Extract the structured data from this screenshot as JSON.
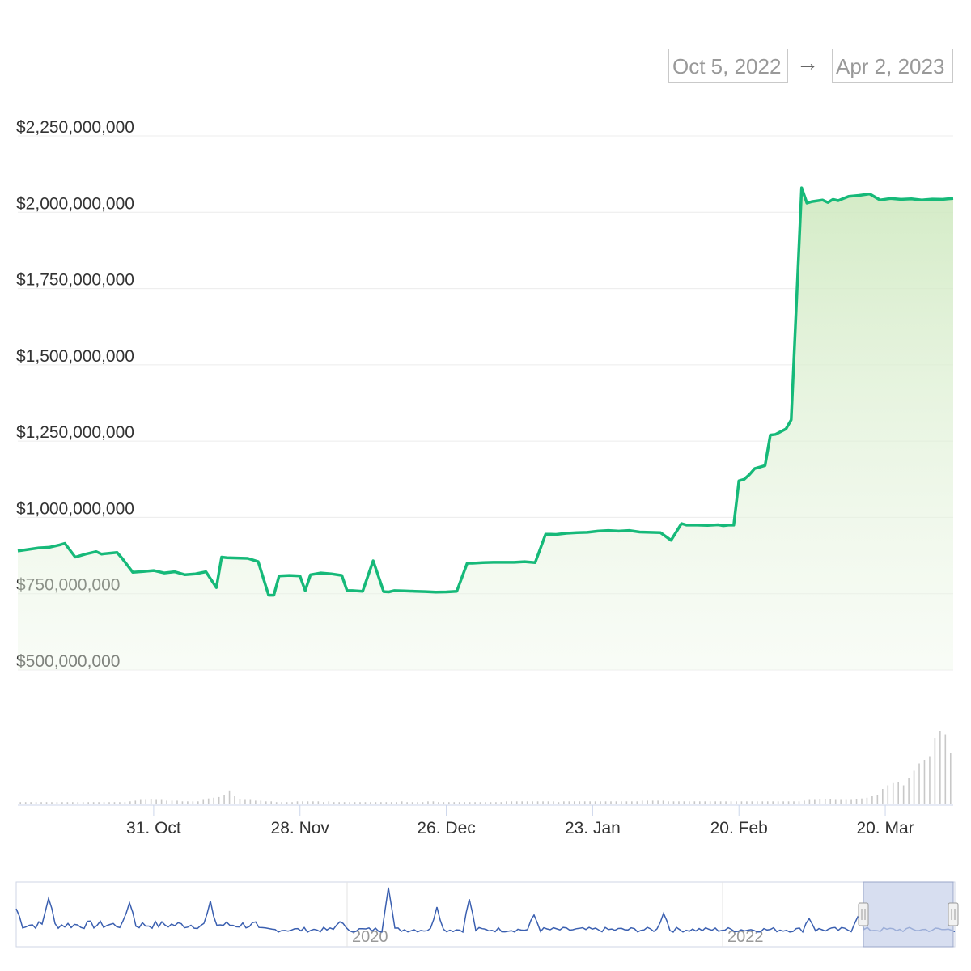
{
  "range_selector": {
    "from": "Oct 5, 2022",
    "arrow": "→",
    "to": "Apr 2, 2023"
  },
  "colors": {
    "line": "#16b979",
    "area_top": "#cfe9c0",
    "volume": "#c8c8c8",
    "navigator_line": "#3a5fb0",
    "navigator_mask": "#c6d0ea"
  },
  "chart_data": {
    "type": "area",
    "ylim": [
      500000000,
      2250000000
    ],
    "y_ticks": [
      500000000,
      750000000,
      1000000000,
      1250000000,
      1500000000,
      1750000000,
      2000000000,
      2250000000
    ],
    "y_tick_labels": [
      "$500,000,000",
      "$750,000,000",
      "$1,000,000,000",
      "$1,250,000,000",
      "$1,500,000,000",
      "$1,750,000,000",
      "$2,000,000,000",
      "$2,250,000,000"
    ],
    "x_range": [
      "2022-10-05",
      "2023-04-02"
    ],
    "x_ticks": [
      "2022-10-31",
      "2022-11-28",
      "2022-12-26",
      "2023-01-23",
      "2023-02-20",
      "2023-03-20"
    ],
    "x_tick_labels": [
      "31. Oct",
      "28. Nov",
      "26. Dec",
      "23. Jan",
      "20. Feb",
      "20. Mar"
    ],
    "grid": true,
    "series": [
      {
        "x": [
          "2022-10-05",
          "2022-10-07",
          "2022-10-09",
          "2022-10-11",
          "2022-10-13",
          "2022-10-14",
          "2022-10-16",
          "2022-10-18",
          "2022-10-20",
          "2022-10-21",
          "2022-10-24",
          "2022-10-25",
          "2022-10-27",
          "2022-10-29",
          "2022-10-31",
          "2022-11-02",
          "2022-11-04",
          "2022-11-06",
          "2022-11-08",
          "2022-11-10",
          "2022-11-12",
          "2022-11-13",
          "2022-11-14",
          "2022-11-16",
          "2022-11-18",
          "2022-11-20",
          "2022-11-22",
          "2022-11-23",
          "2022-11-24",
          "2022-11-26",
          "2022-11-28",
          "2022-11-29",
          "2022-11-30",
          "2022-12-02",
          "2022-12-04",
          "2022-12-06",
          "2022-12-07",
          "2022-12-08",
          "2022-12-10",
          "2022-12-12",
          "2022-12-14",
          "2022-12-15",
          "2022-12-16",
          "2022-12-18",
          "2022-12-20",
          "2022-12-22",
          "2022-12-24",
          "2022-12-26",
          "2022-12-28",
          "2022-12-30",
          "2022-12-31",
          "2023-01-02",
          "2023-01-04",
          "2023-01-06",
          "2023-01-08",
          "2023-01-10",
          "2023-01-12",
          "2023-01-14",
          "2023-01-15",
          "2023-01-16",
          "2023-01-18",
          "2023-01-20",
          "2023-01-22",
          "2023-01-24",
          "2023-01-26",
          "2023-01-28",
          "2023-01-30",
          "2023-02-01",
          "2023-02-03",
          "2023-02-05",
          "2023-02-07",
          "2023-02-09",
          "2023-02-10",
          "2023-02-12",
          "2023-02-14",
          "2023-02-16",
          "2023-02-17",
          "2023-02-18",
          "2023-02-19",
          "2023-02-20",
          "2023-02-21",
          "2023-02-22",
          "2023-02-23",
          "2023-02-24",
          "2023-02-25",
          "2023-02-26",
          "2023-02-27",
          "2023-03-01",
          "2023-03-02",
          "2023-03-04",
          "2023-03-05",
          "2023-03-06",
          "2023-03-08",
          "2023-03-09",
          "2023-03-10",
          "2023-03-11",
          "2023-03-12",
          "2023-03-13",
          "2023-03-15",
          "2023-03-17",
          "2023-03-19",
          "2023-03-21",
          "2023-03-23",
          "2023-03-25",
          "2023-03-27",
          "2023-03-29",
          "2023-03-31",
          "2023-04-01",
          "2023-04-02"
        ],
        "y": [
          890000000,
          895000000,
          900000000,
          902000000,
          910000000,
          915000000,
          870000000,
          880000000,
          888000000,
          880000000,
          885000000,
          865000000,
          820000000,
          823000000,
          826000000,
          818000000,
          822000000,
          812000000,
          815000000,
          822000000,
          770000000,
          870000000,
          868000000,
          867000000,
          866000000,
          855000000,
          745000000,
          745000000,
          808000000,
          810000000,
          808000000,
          760000000,
          812000000,
          818000000,
          815000000,
          810000000,
          760000000,
          760000000,
          758000000,
          858000000,
          757000000,
          756000000,
          760000000,
          759000000,
          758000000,
          757000000,
          755000000,
          756000000,
          758000000,
          850000000,
          850000000,
          852000000,
          853000000,
          853000000,
          853000000,
          855000000,
          852000000,
          945000000,
          945000000,
          944000000,
          948000000,
          950000000,
          951000000,
          955000000,
          957000000,
          955000000,
          957000000,
          952000000,
          951000000,
          950000000,
          925000000,
          980000000,
          975000000,
          975000000,
          974000000,
          976000000,
          973000000,
          975000000,
          975000000,
          1120000000,
          1125000000,
          1140000000,
          1160000000,
          1165000000,
          1170000000,
          1270000000,
          1272000000,
          1290000000,
          1320000000,
          2080000000,
          2030000000,
          2035000000,
          2040000000,
          2032000000,
          2042000000,
          2038000000,
          2045000000,
          2052000000,
          2055000000,
          2060000000,
          2040000000,
          2045000000,
          2042000000,
          2044000000,
          2040000000,
          2043000000,
          2042000000,
          2044000000,
          2045000000
        ]
      }
    ],
    "volume": [
      0.02,
      0.02,
      0.02,
      0.02,
      0.02,
      0.02,
      0.02,
      0.02,
      0.02,
      0.02,
      0.02,
      0.02,
      0.02,
      0.02,
      0.02,
      0.02,
      0.02,
      0.02,
      0.02,
      0.02,
      0.02,
      0.03,
      0.04,
      0.05,
      0.05,
      0.06,
      0.05,
      0.05,
      0.04,
      0.04,
      0.04,
      0.03,
      0.03,
      0.03,
      0.03,
      0.05,
      0.07,
      0.08,
      0.09,
      0.12,
      0.18,
      0.1,
      0.06,
      0.05,
      0.05,
      0.04,
      0.04,
      0.03,
      0.03,
      0.02,
      0.02,
      0.02,
      0.02,
      0.03,
      0.03,
      0.03,
      0.03,
      0.03,
      0.02,
      0.03,
      0.02,
      0.02,
      0.02,
      0.02,
      0.02,
      0.02,
      0.02,
      0.02,
      0.02,
      0.02,
      0.02,
      0.02,
      0.02,
      0.03,
      0.02,
      0.02,
      0.02,
      0.02,
      0.03,
      0.03,
      0.02,
      0.02,
      0.02,
      0.02,
      0.02,
      0.02,
      0.02,
      0.02,
      0.02,
      0.02,
      0.02,
      0.02,
      0.02,
      0.03,
      0.03,
      0.03,
      0.03,
      0.03,
      0.03,
      0.03,
      0.03,
      0.03,
      0.03,
      0.02,
      0.03,
      0.03,
      0.03,
      0.03,
      0.03,
      0.03,
      0.03,
      0.03,
      0.03,
      0.03,
      0.03,
      0.03,
      0.03,
      0.03,
      0.03,
      0.04,
      0.04,
      0.04,
      0.04,
      0.04,
      0.03,
      0.03,
      0.03,
      0.03,
      0.03,
      0.03,
      0.03,
      0.03,
      0.03,
      0.03,
      0.03,
      0.03,
      0.03,
      0.03,
      0.03,
      0.03,
      0.03,
      0.03,
      0.03,
      0.03,
      0.03,
      0.03,
      0.03,
      0.03,
      0.03,
      0.03,
      0.04,
      0.05,
      0.05,
      0.06,
      0.06,
      0.06,
      0.05,
      0.05,
      0.05,
      0.05,
      0.06,
      0.07,
      0.08,
      0.1,
      0.12,
      0.2,
      0.25,
      0.28,
      0.3,
      0.25,
      0.35,
      0.45,
      0.55,
      0.6,
      0.65,
      0.9,
      1.0,
      0.95,
      0.7
    ]
  },
  "navigator": {
    "labels": [
      "2020",
      "2022"
    ],
    "handle_glyph": "⏸"
  }
}
